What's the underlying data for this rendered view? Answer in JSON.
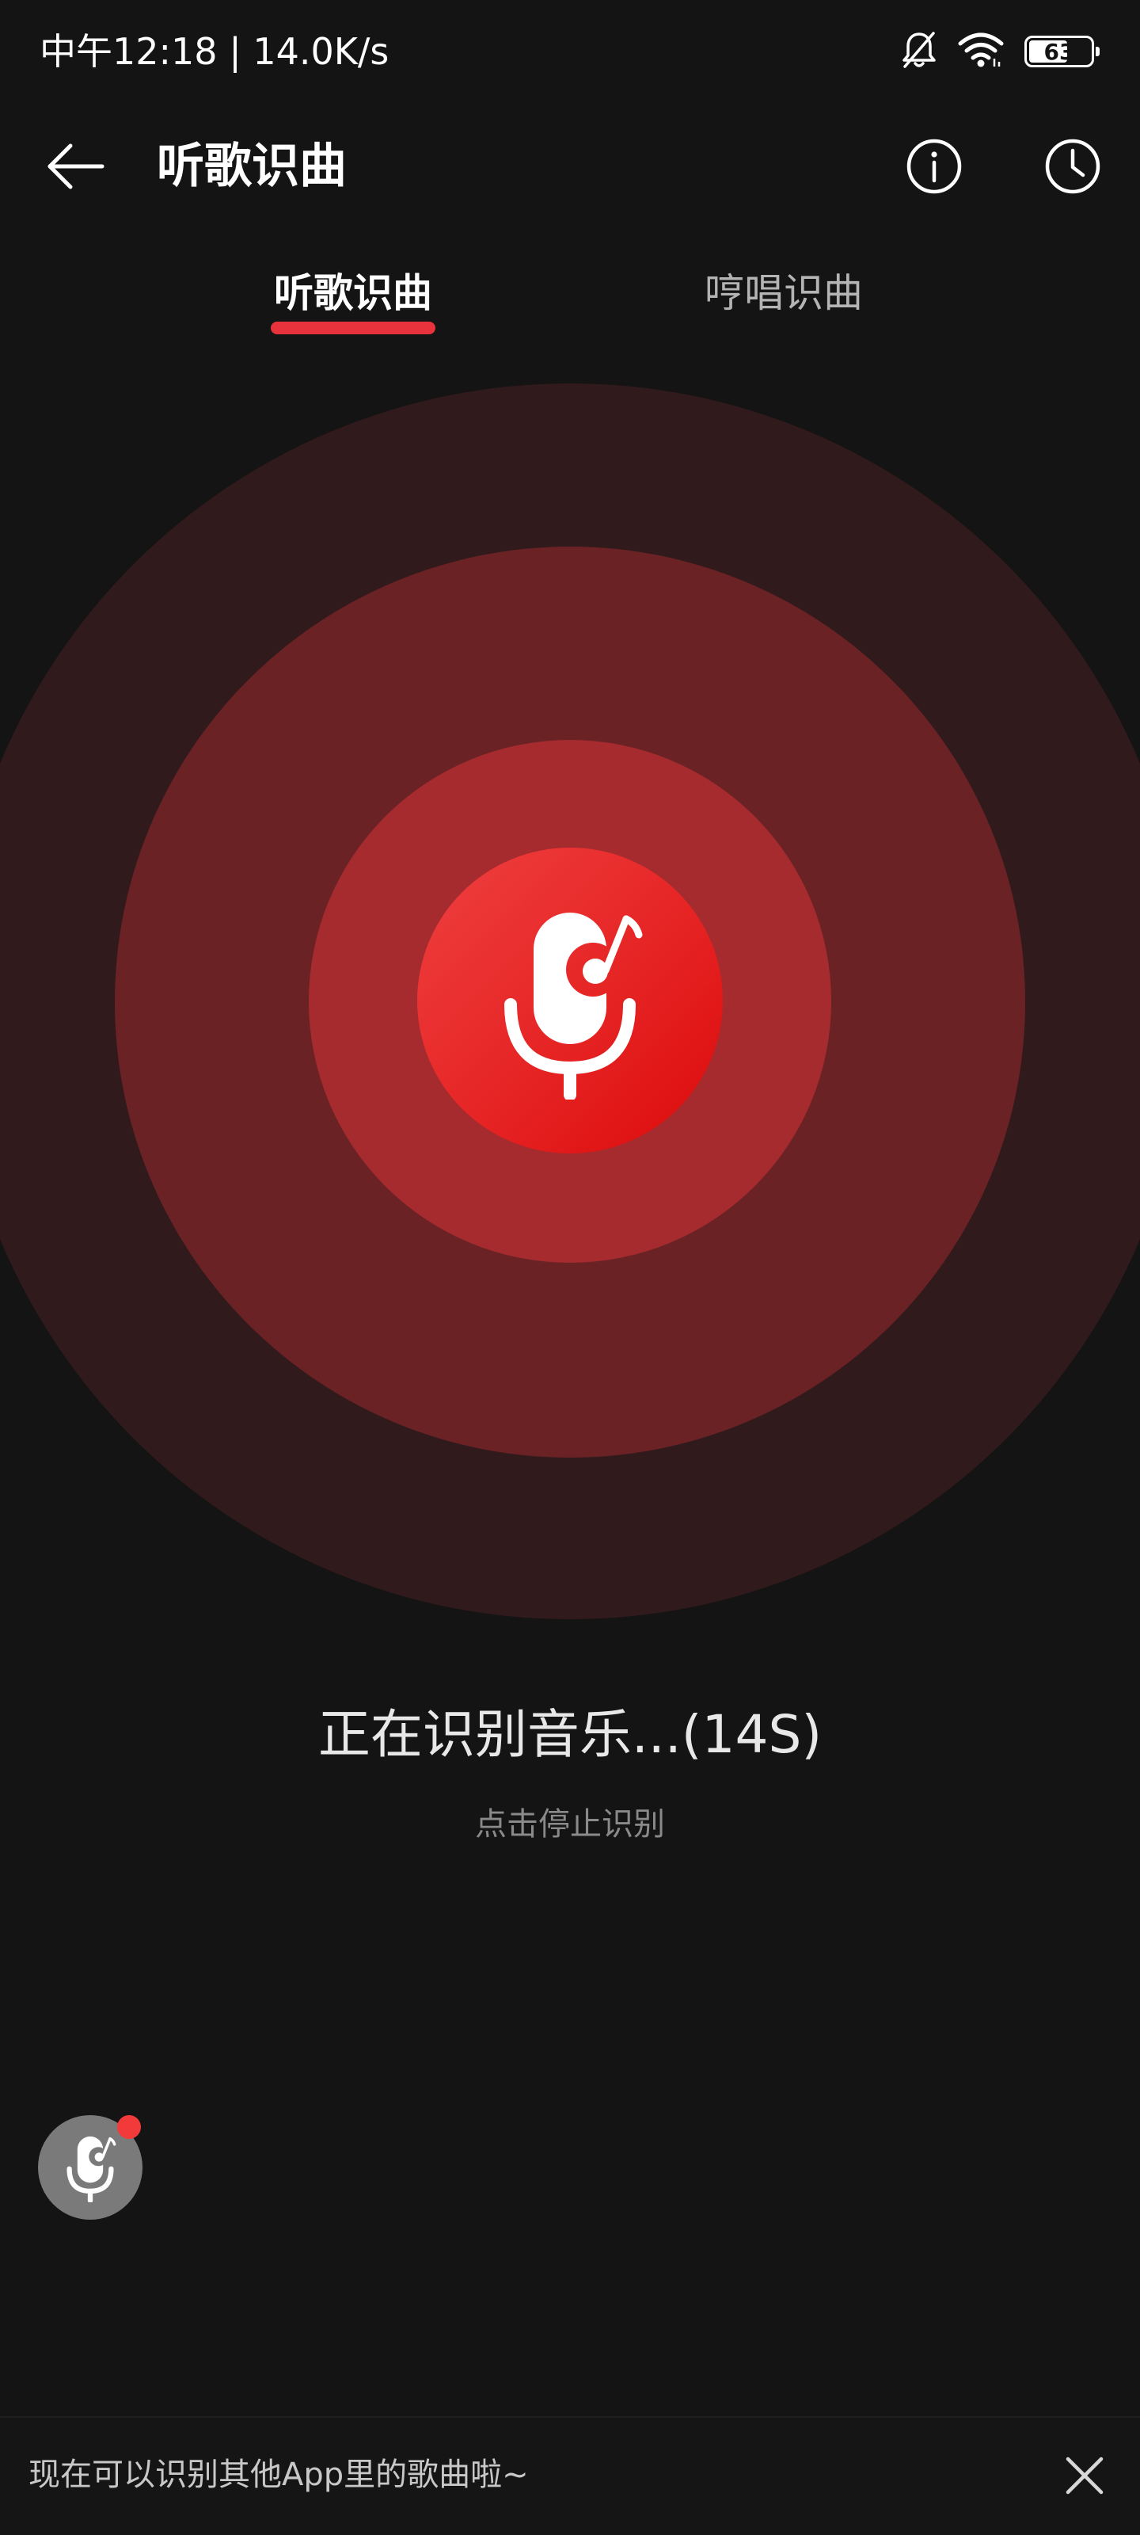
{
  "status_bar": {
    "time": "中午12:18",
    "separator": "|",
    "network_speed": "14.0K/s",
    "battery_level": "63",
    "icons": [
      "mute-icon",
      "wifi-icon",
      "battery-icon"
    ]
  },
  "header": {
    "title": "听歌识曲",
    "back_icon": "back-arrow-icon",
    "info_icon": "info-icon",
    "history_icon": "clock-icon"
  },
  "tabs": [
    {
      "label": "听歌识曲",
      "active": true
    },
    {
      "label": "哼唱识曲",
      "active": false
    }
  ],
  "recognition": {
    "status_text": "正在识别音乐...(14S)",
    "hint": "点击停止识别",
    "mic_icon": "mic-music-icon"
  },
  "floating_button": {
    "icon": "mic-music-icon",
    "badge_color": "#f33a3a"
  },
  "banner": {
    "text": "现在可以识别其他App里的歌曲啦~",
    "close_icon": "close-icon"
  },
  "colors": {
    "background": "#141414",
    "accent": "#e8323c",
    "ring_outer": "#311a1c",
    "ring_middle": "#6a2225",
    "ring_inner": "#a52b2e",
    "core": "#e62424"
  }
}
